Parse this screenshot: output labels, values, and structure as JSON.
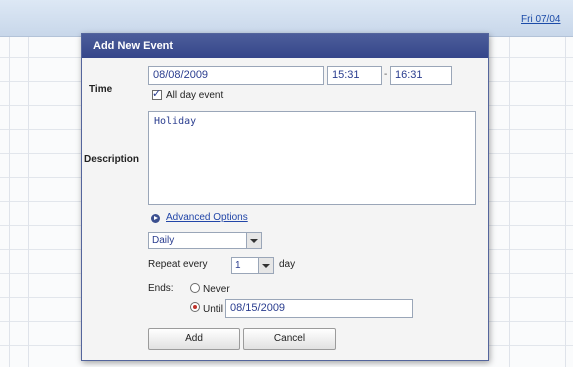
{
  "calendar": {
    "header_days": [
      {
        "label": "Fri 07/04",
        "is_link": true
      }
    ]
  },
  "dialog": {
    "title": "Add New Event",
    "time_label": "Time",
    "start_date": "08/08/2009",
    "start_time": "15:31",
    "time_separator": "-",
    "end_time": "16:31",
    "all_day_checked": true,
    "all_day_label": "All day event",
    "description_label": "Description",
    "description_value": "Holiday",
    "advanced_options_label": "Advanced Options",
    "repeat_frequency": "Daily",
    "repeat_every_label": "Repeat every",
    "repeat_every_value": "1",
    "repeat_unit_label": "day",
    "ends_label": "Ends:",
    "never_label": "Never",
    "until_label": "Until",
    "until_date": "08/15/2009",
    "ends_selected": "until",
    "add_button_label": "Add",
    "cancel_button_label": "Cancel"
  },
  "colors": {
    "title_bar": "#3f4f92",
    "link": "#2246a8",
    "field_text": "#2a3d8f"
  },
  "icons": [
    "checkbox-checked-icon",
    "advanced-options-arrow-icon",
    "dropdown-arrow-icon",
    "radio-icon"
  ]
}
